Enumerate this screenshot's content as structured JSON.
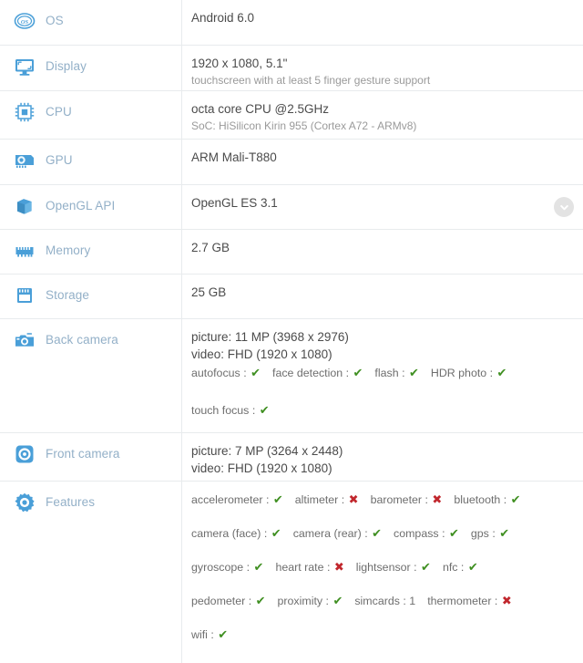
{
  "table": {
    "rows": [
      {
        "key": "os",
        "icon": "os-icon",
        "label": "OS",
        "primary": "Android 6.0",
        "secondary": ""
      },
      {
        "key": "display",
        "icon": "display-monitor-icon",
        "label": "Display",
        "primary": "1920 x 1080, 5.1\"",
        "secondary": "touchscreen with at least 5 finger gesture support"
      },
      {
        "key": "cpu",
        "icon": "cpu-chip-icon",
        "label": "CPU",
        "primary": "octa core CPU @2.5GHz",
        "secondary": "SoC: HiSilicon Kirin 955 (Cortex A72 - ARMv8)"
      },
      {
        "key": "gpu",
        "icon": "gpu-card-icon",
        "label": "GPU",
        "primary": "ARM Mali-T880",
        "secondary": ""
      },
      {
        "key": "opengl",
        "icon": "opengl-cube-icon",
        "label": "OpenGL API",
        "primary": "OpenGL ES 3.1",
        "secondary": "",
        "expand": "chevron-down-icon"
      },
      {
        "key": "memory",
        "icon": "memory-ram-icon",
        "label": "Memory",
        "primary": "2.7 GB",
        "secondary": ""
      },
      {
        "key": "storage",
        "icon": "storage-card-icon",
        "label": "Storage",
        "primary": "25 GB",
        "secondary": ""
      },
      {
        "key": "back_camera",
        "icon": "back-camera-icon",
        "label": "Back camera",
        "primary": "picture: 11 MP (3968 x 2976)",
        "secondary": "video: FHD (1920 x 1080)"
      },
      {
        "key": "front_camera",
        "icon": "front-camera-icon",
        "label": "Front camera",
        "primary": "picture: 7 MP (3264 x 2448)",
        "secondary": "video: FHD (1920 x 1080)"
      },
      {
        "key": "features",
        "icon": "features-gear-icon",
        "label": "Features",
        "primary": "",
        "secondary": ""
      }
    ]
  },
  "back_camera_features": {
    "line1": [
      {
        "name": "autofocus",
        "sep": ":",
        "mark": "yes"
      },
      {
        "name": "face detection",
        "sep": ":",
        "mark": "yes"
      },
      {
        "name": "flash",
        "sep": ":",
        "mark": "yes"
      },
      {
        "name": "HDR photo",
        "sep": ":",
        "mark": "yes"
      }
    ],
    "line2": [
      {
        "name": "touch focus",
        "sep": ":",
        "mark": "yes"
      }
    ]
  },
  "features": {
    "line1": [
      {
        "name": "accelerometer",
        "sep": ":",
        "mark": "yes"
      },
      {
        "name": "altimeter",
        "sep": ":",
        "mark": "no"
      },
      {
        "name": "barometer",
        "sep": ":",
        "mark": "no"
      },
      {
        "name": "bluetooth",
        "sep": ":",
        "mark": "yes"
      }
    ],
    "line2": [
      {
        "name": "camera (face)",
        "sep": ":",
        "mark": "yes"
      },
      {
        "name": "camera (rear)",
        "sep": ":",
        "mark": "yes"
      },
      {
        "name": "compass",
        "sep": ":",
        "mark": "yes"
      },
      {
        "name": "gps",
        "sep": ":",
        "mark": "yes"
      }
    ],
    "line3": [
      {
        "name": "gyroscope",
        "sep": ":",
        "mark": "yes"
      },
      {
        "name": "heart rate",
        "sep": ":",
        "mark": "no"
      },
      {
        "name": "lightsensor",
        "sep": ":",
        "mark": "yes"
      },
      {
        "name": "nfc",
        "sep": ":",
        "mark": "yes"
      }
    ],
    "line4": [
      {
        "name": "pedometer",
        "sep": ":",
        "mark": "yes"
      },
      {
        "name": "proximity",
        "sep": ":",
        "mark": "yes"
      },
      {
        "name": "simcards",
        "sep": ":",
        "mark": "1"
      },
      {
        "name": "thermometer",
        "sep": ":",
        "mark": "no"
      }
    ],
    "line5": [
      {
        "name": "wifi",
        "sep": ":",
        "mark": "yes"
      }
    ]
  },
  "marks": {
    "yes_glyph": "✔",
    "no_glyph": "✖"
  },
  "colors": {
    "icon_blue": "#4a9fd8",
    "label_blue": "#93b0c8",
    "value_dark": "#4b4b4b",
    "value_grey": "#9a9a9a",
    "check_green": "#3f8f21",
    "cross_red": "#c1272d",
    "divider": "#e8ebed",
    "background": "#ffffff"
  }
}
